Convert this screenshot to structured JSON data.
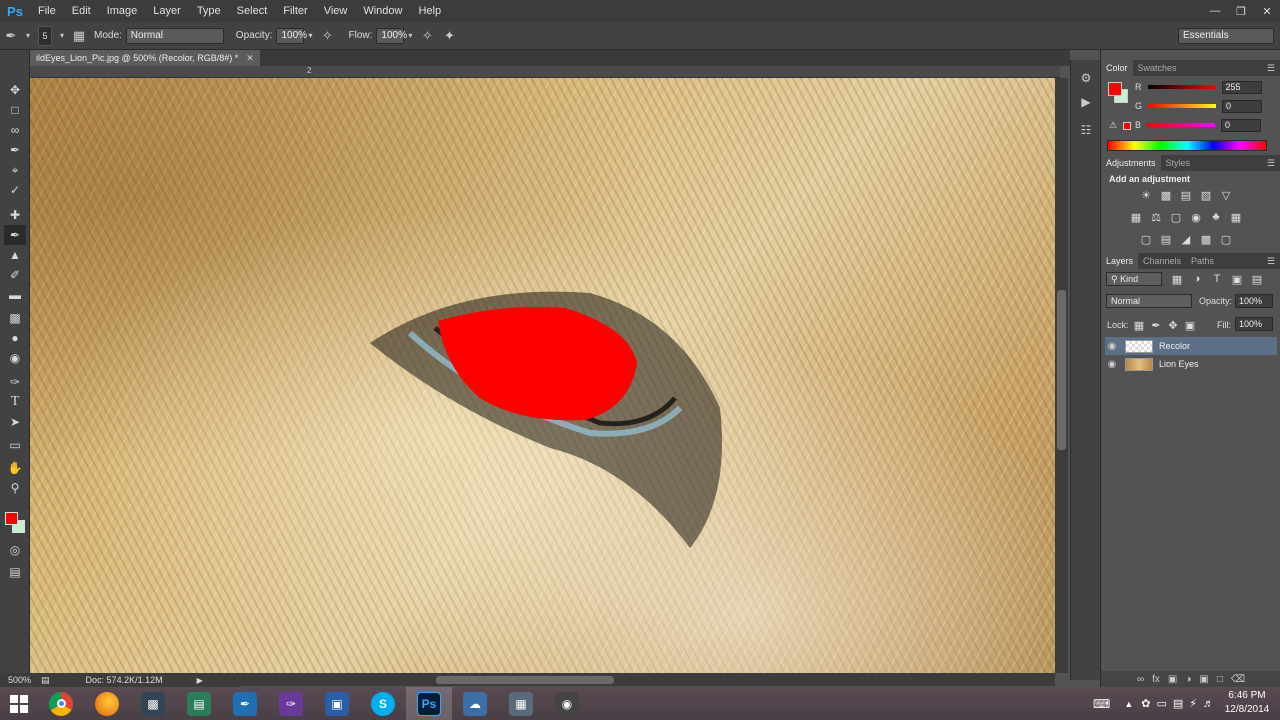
{
  "menubar": {
    "logo": "Ps",
    "items": [
      "File",
      "Edit",
      "Image",
      "Layer",
      "Type",
      "Select",
      "Filter",
      "View",
      "Window",
      "Help"
    ]
  },
  "options": {
    "brush_size": "5",
    "mode_label": "Mode:",
    "mode_value": "Normal",
    "opacity_label": "Opacity:",
    "opacity_value": "100%",
    "flow_label": "Flow:",
    "flow_value": "100%",
    "workspace": "Essentials"
  },
  "document": {
    "tab_title": "ildEyes_Lion_Pic.jpg @ 500% (Recolor, RGB/8#) *",
    "ruler_mark": "2",
    "zoom": "500%",
    "doc_size": "Doc: 574.2K/1.12M"
  },
  "color_panel": {
    "tabs": [
      "Color",
      "Swatches"
    ],
    "foreground": "#ff0000",
    "background": "#c8f0d0",
    "r_label": "R",
    "r_value": "255",
    "g_label": "G",
    "g_value": "0",
    "b_label": "B",
    "b_value": "0"
  },
  "adjustments_panel": {
    "tabs": [
      "Adjustments",
      "Styles"
    ],
    "heading": "Add an adjustment"
  },
  "layers_panel": {
    "tabs": [
      "Layers",
      "Channels",
      "Paths"
    ],
    "kind_filter": "Kind",
    "blend_mode": "Normal",
    "opacity_label": "Opacity:",
    "opacity_value": "100%",
    "lock_label": "Lock:",
    "fill_label": "Fill:",
    "fill_value": "100%",
    "layers": [
      {
        "name": "Recolor",
        "selected": true
      },
      {
        "name": "Lion Eyes",
        "selected": false
      }
    ]
  },
  "taskbar": {
    "time": "6:46 PM",
    "date": "12/8/2014"
  },
  "colors": {
    "accent": "#31a8ff",
    "recolor_red": "#ff0000"
  }
}
